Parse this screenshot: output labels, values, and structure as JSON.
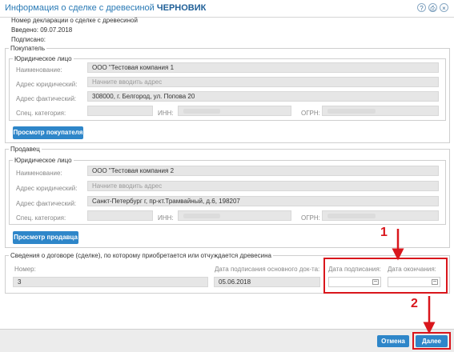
{
  "window": {
    "title_prefix": "Информация о сделке с древесиной ",
    "title_status": "ЧЕРНОВИК",
    "buttons": [
      "?",
      "⎙",
      "×"
    ]
  },
  "info": {
    "declaration": "Номер декларации о сделке с древесиной",
    "entered": "Введено: 09.07.2018",
    "signed": "Подписано:"
  },
  "buyer": {
    "legend": "Покупатель",
    "sublegend": "Юридическое лицо",
    "name_label": "Наименование:",
    "name_value": "ООО \"Тестовая компания  1",
    "legal_addr_label": "Адрес юридический:",
    "legal_addr_placeholder": "Начните вводить адрес",
    "actual_addr_label": "Адрес фактический:",
    "actual_addr_value": "308000, г. Белгород, ул. Попова 20",
    "spec_label": "Спец. категория:",
    "inn_label": "ИНН:",
    "ogrn_label": "ОГРН:",
    "view_button": "Просмотр покупателя"
  },
  "seller": {
    "legend": "Продавец",
    "sublegend": "Юридическое лицо",
    "name_label": "Наименование:",
    "name_value": "ООО \"Тестовая компания 2",
    "legal_addr_label": "Адрес юридический:",
    "legal_addr_placeholder": "Начните вводить адрес",
    "actual_addr_label": "Адрес фактический:",
    "actual_addr_value": "Санкт-Петербург г, пр-кт.Трамвайный, д.6, 198207",
    "spec_label": "Спец. категория:",
    "inn_label": "ИНН:",
    "ogrn_label": "ОГРН:",
    "view_button": "Просмотр продавца"
  },
  "contract": {
    "legend": "Сведения о договоре (сделке), по которому приобретается или отчуждается древесина",
    "number_label": "Номер:",
    "number_value": "3",
    "doc_date_label": "Дата подписания основного док-та:",
    "doc_date_value": "05.06.2018",
    "sign_date_label": "Дата подписания:",
    "end_date_label": "Дата окончания:"
  },
  "footer": {
    "cancel": "Отмена",
    "next": "Далее"
  },
  "annotations": {
    "marker1": "1",
    "marker2": "2",
    "color": "#d9161c"
  }
}
